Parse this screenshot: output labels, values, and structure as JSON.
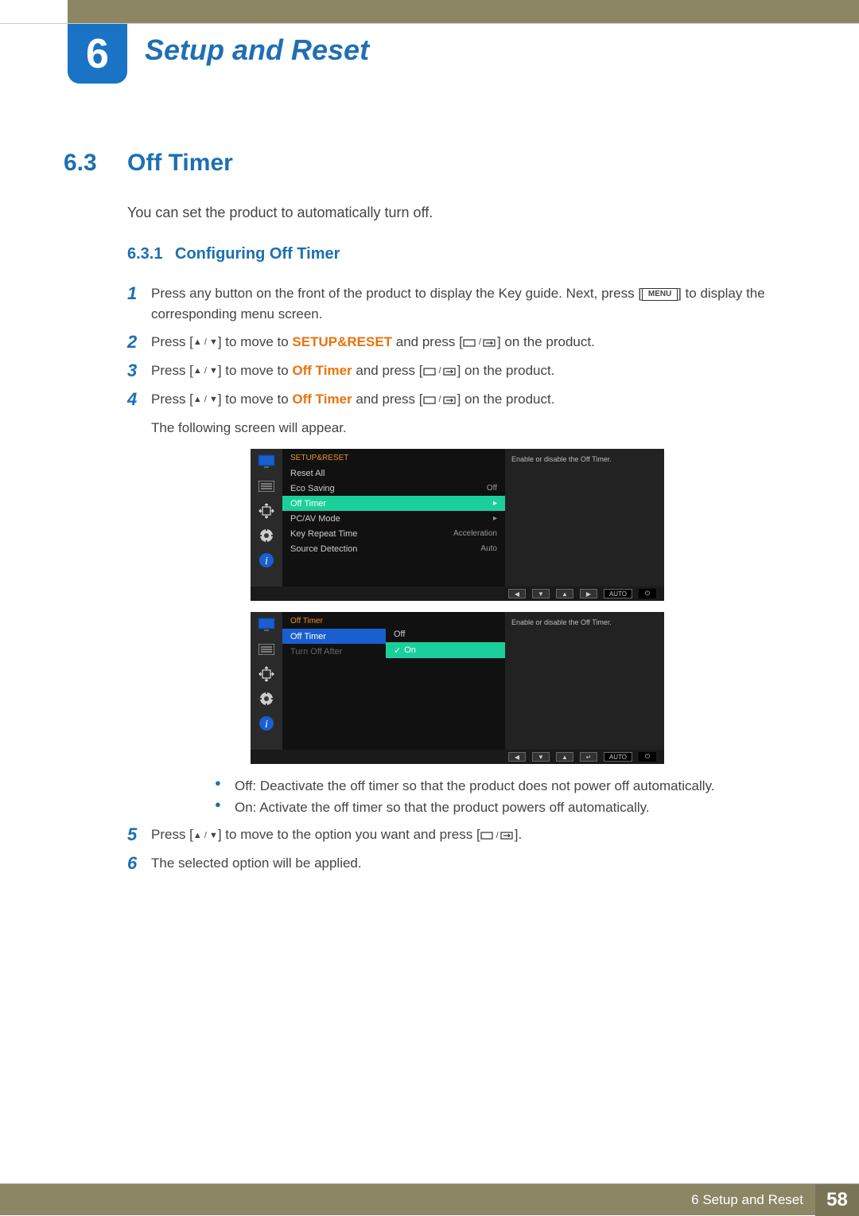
{
  "header": {
    "chapter_num": "6",
    "chapter_title": "Setup and Reset"
  },
  "section": {
    "number": "6.3",
    "title": "Off Timer",
    "intro": "You can set the product to automatically turn off."
  },
  "subsection": {
    "number": "6.3.1",
    "title": "Configuring Off Timer"
  },
  "steps": {
    "s1": {
      "n": "1",
      "a": "Press any button on the front of the product to display the Key guide. Next, press [",
      "menu": "MENU",
      "b": "] to display the corresponding menu screen."
    },
    "s2": {
      "n": "2",
      "a": "Press [",
      "b": "] to move to ",
      "hl": "SETUP&RESET",
      "c": " and press [",
      "d": "] on the product."
    },
    "s3": {
      "n": "3",
      "a": "Press [",
      "b": "] to move to ",
      "hl": "Off Timer",
      "c": " and press [",
      "d": "] on the product."
    },
    "s4": {
      "n": "4",
      "a": "Press [",
      "b": "] to move to ",
      "hl": "Off Timer",
      "c": " and press [",
      "d": "] on the product.",
      "note": "The following screen will appear."
    },
    "s5": {
      "n": "5",
      "a": "Press [",
      "b": "] to move to the option you want and press [",
      "c": "]."
    },
    "s6": {
      "n": "6",
      "a": "The selected option will be applied."
    }
  },
  "bullets": {
    "off": {
      "hl": "Off",
      "t": ": Deactivate the off timer so that the product does not power off automatically."
    },
    "on": {
      "hl": "On",
      "t": ": Activate the off timer so that the product powers off automatically."
    }
  },
  "osd1": {
    "title": "SETUP&RESET",
    "desc": "Enable or disable the Off Timer.",
    "rows": {
      "r0": {
        "l": "Reset All",
        "v": ""
      },
      "r1": {
        "l": "Eco Saving",
        "v": "Off"
      },
      "r2": {
        "l": "Off Timer",
        "v": "▸"
      },
      "r3": {
        "l": "PC/AV Mode",
        "v": "▸"
      },
      "r4": {
        "l": "Key Repeat Time",
        "v": "Acceleration"
      },
      "r5": {
        "l": "Source Detection",
        "v": "Auto"
      }
    },
    "nav": {
      "left": "◀",
      "down": "▼",
      "up": "▲",
      "right": "▶",
      "auto": "AUTO",
      "power": "⏻"
    }
  },
  "osd2": {
    "title": "Off Timer",
    "desc": "Enable or disable the Off Timer.",
    "rows": {
      "r0": {
        "l": "Off Timer",
        "v": ""
      },
      "r1": {
        "l": "Turn Off After",
        "v": ""
      }
    },
    "dropdown": {
      "opt0": "Off",
      "opt1": "On",
      "check": "✓"
    },
    "nav": {
      "left": "◀",
      "down": "▼",
      "up": "▲",
      "enter": "↵",
      "auto": "AUTO",
      "power": "⏻"
    }
  },
  "footer": {
    "chapter_ref_num": "6",
    "text": "Setup and Reset",
    "page": "58"
  }
}
